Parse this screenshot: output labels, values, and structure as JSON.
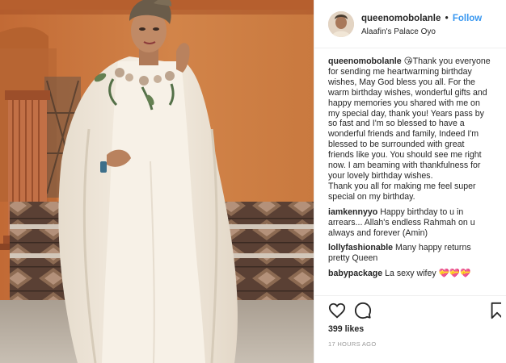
{
  "post": {
    "username": "queenomobolanle",
    "dot": "•",
    "follow_label": "Follow",
    "location": "Alaafin's Palace Oyo"
  },
  "caption": {
    "username": "queenomobolanle",
    "lines": [
      "😘Thank you everyone",
      "for sending me heartwarming birthday",
      "wishes, May God bless you all. For the",
      "warm birthday wishes, wonderful gifts and",
      "happy memories you shared with me on",
      "my special day, thank you! Years pass by",
      "so fast and I'm so blessed to have a",
      "wonderful friends and family, Indeed I'm",
      "blessed to be surrounded with great",
      "friends like you. You should see me right",
      "now. I am beaming with thankfulness for",
      "your lovely birthday wishes.",
      "Thank you all for making me feel super",
      "special on my birthday."
    ]
  },
  "comments": [
    {
      "username": "iamkennyyo",
      "lines": [
        "Happy birthday to u in",
        "arrears... Allah's endless Rahmah on u",
        "always and forever (Amin)"
      ]
    },
    {
      "username": "lollyfashionable",
      "lines": [
        "Many happy returns",
        "pretty Queen"
      ]
    },
    {
      "username": "babypackage",
      "lines": [
        "La sexy wifey 💝💝💝"
      ]
    }
  ],
  "actions": {
    "like_icon": "heart-outline-icon",
    "comment_icon": "speech-bubble-icon",
    "save_icon": "bookmark-icon"
  },
  "likes": "399 likes",
  "timestamp": "17 HOURS AGO",
  "colors": {
    "link_blue": "#3897f0",
    "text": "#262626",
    "muted": "#999999",
    "wall_orange": "#c9773f",
    "gown_cream": "#f2e9dc"
  }
}
